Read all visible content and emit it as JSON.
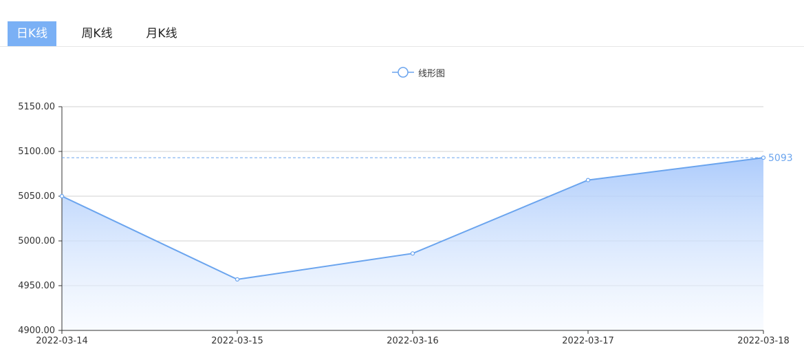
{
  "tabs": [
    {
      "label": "日K线",
      "active": true
    },
    {
      "label": "周K线",
      "active": false
    },
    {
      "label": "月K线",
      "active": false
    }
  ],
  "colors": {
    "accent": "#6aa4ee",
    "tab_active": "#7ab0f5",
    "grid": "#d0d0d0"
  },
  "chart_data": {
    "type": "area",
    "legend": "线形图",
    "legend_position": "top-center",
    "x": [
      "2022-03-14",
      "2022-03-15",
      "2022-03-16",
      "2022-03-17",
      "2022-03-18"
    ],
    "series": [
      {
        "name": "线形图",
        "values": [
          5050,
          4957,
          4986,
          5068,
          5093
        ]
      }
    ],
    "ylim": [
      4900,
      5150
    ],
    "yticks": [
      "4900.00",
      "4950.00",
      "5000.00",
      "5050.00",
      "5100.00",
      "5150.00"
    ],
    "grid": true,
    "markline": {
      "value": 5093,
      "label": "5093"
    }
  }
}
